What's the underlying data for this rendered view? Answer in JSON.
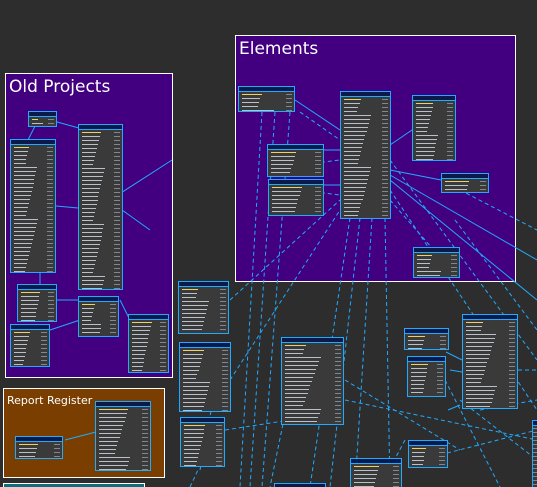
{
  "groups": [
    {
      "name": "old-projects",
      "label": "Old Projects",
      "color": "#420080"
    },
    {
      "name": "elements",
      "label": "Elements",
      "color": "#420080"
    },
    {
      "name": "report-register",
      "label": "Report Register",
      "color": "#7a3f00"
    },
    {
      "name": "bottom-area",
      "label": "",
      "color": "#0c6f7c"
    }
  ],
  "colors": {
    "canvas": "#2d2d2d",
    "group_border": "#ffffff",
    "table_border": "#22aaff",
    "table_body": "#3a3a3a",
    "link": "#22aaff"
  }
}
